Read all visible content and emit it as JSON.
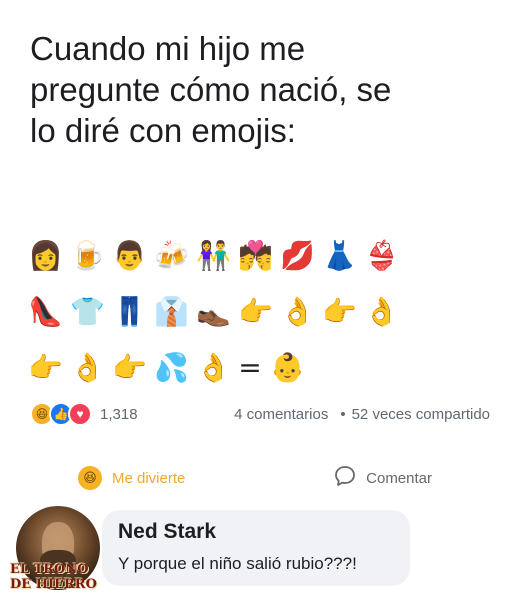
{
  "post": {
    "text_lines": [
      "Cuando mi hijo me",
      "pregunte cómo nació, se",
      "lo diré con emojis:"
    ]
  },
  "emoji_rows": [
    [
      "👩",
      "🍺",
      "👨",
      "🍻",
      "👫",
      "💏",
      "💋",
      "👗",
      "👙"
    ],
    [
      "👠",
      "👕",
      "👖",
      "👔",
      "👞",
      "👉",
      "👌",
      "👉",
      "👌"
    ],
    [
      "👉",
      "👌",
      "👉",
      "💦",
      "👌",
      "=",
      "👶"
    ]
  ],
  "emoji_names": [
    [
      "woman-icon",
      "beer-mug-icon",
      "man-icon",
      "clinking-beers-icon",
      "couple-icon",
      "kiss-couple-icon",
      "kiss-mark-icon",
      "dress-icon",
      "bikini-icon"
    ],
    [
      "high-heel-icon",
      "tshirt-icon",
      "jeans-icon",
      "necktie-icon",
      "shoe-icon",
      "pointing-right-icon",
      "ok-hand-icon",
      "pointing-right-icon",
      "ok-hand-icon"
    ],
    [
      "pointing-right-icon",
      "ok-hand-icon",
      "pointing-right-icon",
      "sweat-droplets-icon",
      "ok-hand-icon",
      "equals-sign",
      "baby-icon"
    ]
  ],
  "reactions": {
    "icons": [
      "haha-reaction-icon",
      "like-reaction-icon",
      "love-reaction-icon"
    ],
    "count": "1,318",
    "comments": "4 comentarios",
    "separator": "•",
    "shares": "52 veces compartido"
  },
  "actions": {
    "haha_label": "Me divierte",
    "comment_label": "Comentar",
    "haha_color": "#f0a82e"
  },
  "comment": {
    "author": "Ned Stark",
    "text": "Y porque el niño salió rubio???!"
  },
  "watermark": {
    "line1": "EL TRONO",
    "line2": "DE HIERRO"
  }
}
